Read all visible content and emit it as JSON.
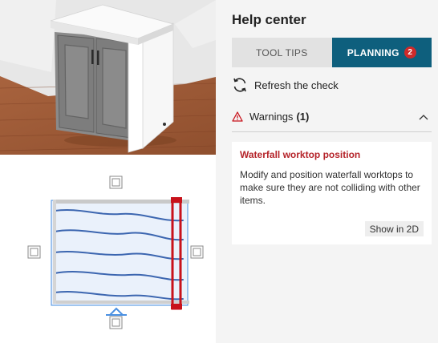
{
  "help_center": {
    "title": "Help center",
    "tabs": [
      {
        "label": "TOOL TIPS",
        "active": false
      },
      {
        "label": "PLANNING",
        "active": true,
        "badge": "2"
      }
    ],
    "refresh_label": "Refresh the check",
    "warnings": {
      "label": "Warnings",
      "count": "(1)",
      "expanded": true,
      "items": [
        {
          "title": "Waterfall worktop position",
          "description": "Modify and position waterfall worktops to make sure they are not colliding with other items.",
          "action_label": "Show in 2D"
        }
      ]
    }
  },
  "colors": {
    "active_tab": "#0e5f7d",
    "badge": "#cf2a2a",
    "warning_title": "#b5242a",
    "highlight": "#c8121b",
    "selection": "#4a90e2"
  },
  "icons": {
    "refresh": "refresh-icon",
    "warning": "warning-triangle-icon",
    "collapse": "chevron-up-icon"
  }
}
